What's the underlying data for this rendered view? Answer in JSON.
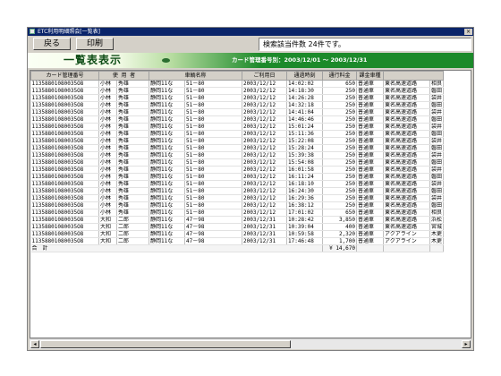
{
  "window": {
    "title": "ETC利用明細照会[一覧表]",
    "close_glyph": "×"
  },
  "toolbar": {
    "back_label": "戻る",
    "print_label": "印刷",
    "info_text": "検索該当件数 24件です。"
  },
  "banner": {
    "title": "一覧表表示",
    "range_text": "カード管理番号別：2003/12/01 〜 2003/12/31"
  },
  "table": {
    "columns": [
      "カード管理番号",
      "使 用 者",
      "",
      "車輌名称",
      "ご利用日",
      "通過時刻",
      "通行料金",
      "課金車種",
      ""
    ],
    "rows": [
      [
        "11358801080035O8",
        "小林",
        "秀雄",
        "静岡11な",
        "51－80",
        "2003/12/12",
        "14:02:02",
        "650",
        "普通車",
        "東名高速道路",
        "相良"
      ],
      [
        "11358801080035O8",
        "小林",
        "秀雄",
        "静岡11な",
        "51－80",
        "2003/12/12",
        "14:18:30",
        "250",
        "普通車",
        "東名高速道路",
        "磐田"
      ],
      [
        "11358801080035O8",
        "小林",
        "秀雄",
        "静岡11な",
        "51－80",
        "2003/12/12",
        "14:26:28",
        "250",
        "普通車",
        "東名高速道路",
        "袋井"
      ],
      [
        "11358801080035O8",
        "小林",
        "秀雄",
        "静岡11な",
        "51－80",
        "2003/12/12",
        "14:32:18",
        "250",
        "普通車",
        "東名高速道路",
        "磐田"
      ],
      [
        "11358801080035O8",
        "小林",
        "秀雄",
        "静岡11な",
        "51－80",
        "2003/12/12",
        "14:41:04",
        "250",
        "普通車",
        "東名高速道路",
        "袋井"
      ],
      [
        "11358801080035O8",
        "小林",
        "秀雄",
        "静岡11な",
        "51－80",
        "2003/12/12",
        "14:46:46",
        "250",
        "普通車",
        "東名高速道路",
        "磐田"
      ],
      [
        "11358801080035O8",
        "小林",
        "秀雄",
        "静岡11な",
        "51－80",
        "2003/12/12",
        "15:01:24",
        "250",
        "普通車",
        "東名高速道路",
        "袋井"
      ],
      [
        "11358801080035O8",
        "小林",
        "秀雄",
        "静岡11な",
        "51－80",
        "2003/12/12",
        "15:11:36",
        "250",
        "普通車",
        "東名高速道路",
        "磐田"
      ],
      [
        "11358801080035O8",
        "小林",
        "秀雄",
        "静岡11な",
        "51－80",
        "2003/12/12",
        "15:22:08",
        "250",
        "普通車",
        "東名高速道路",
        "袋井"
      ],
      [
        "11358801080035O8",
        "小林",
        "秀雄",
        "静岡11な",
        "51－80",
        "2003/12/12",
        "15:28:24",
        "250",
        "普通車",
        "東名高速道路",
        "磐田"
      ],
      [
        "11358801080035O8",
        "小林",
        "秀雄",
        "静岡11な",
        "51－80",
        "2003/12/12",
        "15:39:38",
        "250",
        "普通車",
        "東名高速道路",
        "袋井"
      ],
      [
        "11358801080035O8",
        "小林",
        "秀雄",
        "静岡11な",
        "51－80",
        "2003/12/12",
        "15:54:08",
        "250",
        "普通車",
        "東名高速道路",
        "磐田"
      ],
      [
        "11358801080035O8",
        "小林",
        "秀雄",
        "静岡11な",
        "51－80",
        "2003/12/12",
        "16:01:58",
        "250",
        "普通車",
        "東名高速道路",
        "袋井"
      ],
      [
        "11358801080035O8",
        "小林",
        "秀雄",
        "静岡11な",
        "51－80",
        "2003/12/12",
        "16:11:24",
        "250",
        "普通車",
        "東名高速道路",
        "磐田"
      ],
      [
        "11358801080035O8",
        "小林",
        "秀雄",
        "静岡11な",
        "51－80",
        "2003/12/12",
        "16:18:10",
        "250",
        "普通車",
        "東名高速道路",
        "袋井"
      ],
      [
        "11358801080035O8",
        "小林",
        "秀雄",
        "静岡11な",
        "51－80",
        "2003/12/12",
        "16:24:30",
        "250",
        "普通車",
        "東名高速道路",
        "磐田"
      ],
      [
        "11358801080035O8",
        "小林",
        "秀雄",
        "静岡11な",
        "51－80",
        "2003/12/12",
        "16:29:36",
        "250",
        "普通車",
        "東名高速道路",
        "袋井"
      ],
      [
        "11358801080035O8",
        "小林",
        "秀雄",
        "静岡11な",
        "51－80",
        "2003/12/12",
        "16:38:12",
        "250",
        "普通車",
        "東名高速道路",
        "磐田"
      ],
      [
        "11358801080035O8",
        "小林",
        "秀雄",
        "静岡11な",
        "51－80",
        "2003/12/12",
        "17:01:02",
        "650",
        "普通車",
        "東名高速道路",
        "相良"
      ],
      [
        "11358801080035O8",
        "大和",
        "二郎",
        "静岡11な",
        "47－98",
        "2003/12/31",
        "10:28:42",
        "3,850",
        "普通車",
        "東名高速道路",
        "浜松"
      ],
      [
        "11358801080035O8",
        "大和",
        "二郎",
        "静岡11な",
        "47－98",
        "2003/12/31",
        "10:39:04",
        "400",
        "普通車",
        "東名高速道路",
        "宮城"
      ],
      [
        "11358801080035O8",
        "大和",
        "二郎",
        "静岡11な",
        "47－98",
        "2003/12/31",
        "10:59:58",
        "2,320",
        "普通車",
        "アクアライン",
        "木更"
      ],
      [
        "11358801080035O8",
        "大和",
        "二郎",
        "静岡11な",
        "47－98",
        "2003/12/31",
        "17:46:48",
        "1,700",
        "普通車",
        "アクアライン",
        "木更"
      ]
    ],
    "total_label": "合　計",
    "total_value": "¥ 14,670"
  },
  "scrollbar": {
    "left_arrow": "◂",
    "right_arrow": "▸"
  },
  "colors": {
    "title_bar": "#0a246a",
    "banner_green": "#1c8a2a",
    "window_face": "#d4d0c8"
  }
}
